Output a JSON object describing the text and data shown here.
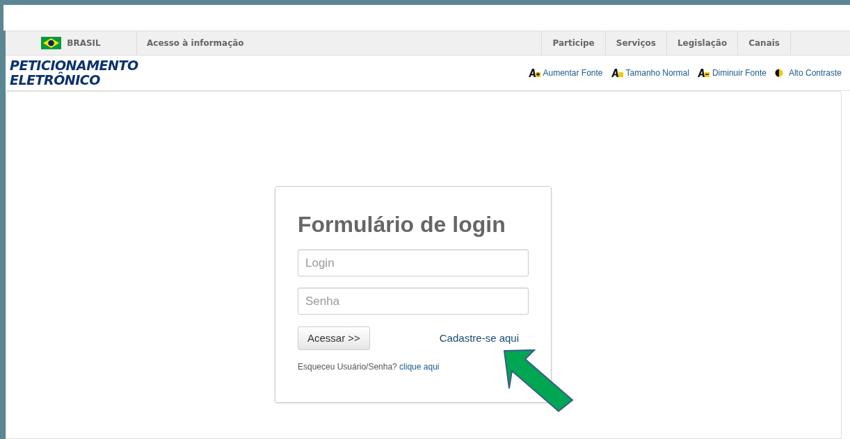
{
  "gov_bar": {
    "country": "BRASIL",
    "left_links": [
      "Acesso à informação"
    ],
    "right_links": [
      "Participe",
      "Serviços",
      "Legislação",
      "Canais"
    ]
  },
  "header": {
    "logo_lines": [
      "PETICIONAMENTO",
      "ELETRÔNICO"
    ],
    "accessibility": [
      {
        "kind": "increase",
        "label": "Aumentar Fonte"
      },
      {
        "kind": "normal",
        "label": "Tamanho Normal"
      },
      {
        "kind": "decrease",
        "label": "Diminuir Fonte"
      },
      {
        "kind": "contrast",
        "label": "Alto Contraste"
      }
    ]
  },
  "login_form": {
    "title": "Formulário de login",
    "fields": [
      {
        "placeholder": "Login"
      },
      {
        "placeholder": "Senha"
      }
    ],
    "submit": "Acessar >>",
    "register_link": "Cadastre-se aqui",
    "forgot": {
      "text": "Esqueceu Usuário/Senha?",
      "link": "clique aqui"
    }
  }
}
